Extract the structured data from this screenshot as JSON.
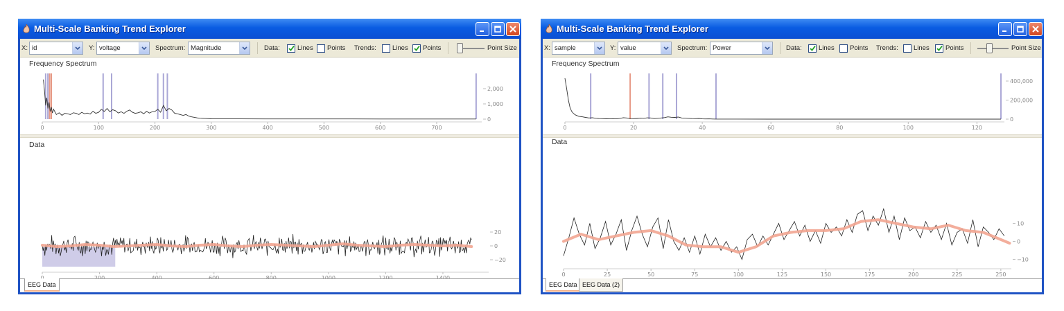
{
  "windows": [
    {
      "title": "Multi-Scale Banking Trend Explorer",
      "toolbar": {
        "x_label": "X:",
        "x_value": "id",
        "y_label": "Y:",
        "y_value": "voltage",
        "spectrum_label": "Spectrum:",
        "spectrum_value": "Magnitude",
        "data_label": "Data:",
        "data_lines": "Lines",
        "data_points": "Points",
        "data_lines_checked": true,
        "data_points_checked": false,
        "trends_label": "Trends:",
        "trends_lines": "Lines",
        "trends_points": "Points",
        "trends_lines_checked": false,
        "trends_points_checked": true,
        "point_size_label": "Point Size",
        "point_size_level": 0.0
      },
      "spectrum_panel": {
        "label": "Frequency Spectrum"
      },
      "data_panel": {
        "label": "Data"
      },
      "tabs": [
        "EEG Data"
      ],
      "active_tab": 0,
      "chart_data": [
        {
          "type": "line",
          "panel": "Frequency Spectrum",
          "x_ticks": [
            0,
            100,
            200,
            300,
            400,
            500,
            600,
            700
          ],
          "xlim": [
            0,
            780
          ],
          "y_ticks": [
            2000,
            1000,
            0
          ],
          "y_tick_labels": [
            "2,000",
            "1,000",
            "0"
          ],
          "ylim": [
            0,
            3000
          ],
          "x": [
            2,
            4,
            6,
            8,
            10,
            12,
            14,
            16,
            18,
            20,
            25,
            30,
            35,
            40,
            45,
            50,
            55,
            60,
            65,
            70,
            75,
            80,
            85,
            90,
            95,
            100,
            105,
            110,
            115,
            120,
            125,
            130,
            135,
            140,
            145,
            150,
            155,
            160,
            165,
            170,
            175,
            180,
            185,
            190,
            195,
            200,
            205,
            210,
            215,
            220,
            225,
            230,
            235,
            240,
            245,
            250,
            255,
            260,
            265,
            270,
            275,
            280,
            285,
            290,
            300,
            320,
            350,
            400,
            450,
            500,
            550,
            600,
            650,
            700,
            750,
            770
          ],
          "y": [
            2600,
            1800,
            900,
            1400,
            700,
            1100,
            500,
            800,
            400,
            650,
            300,
            420,
            250,
            380,
            350,
            300,
            420,
            380,
            300,
            450,
            350,
            400,
            330,
            520,
            380,
            450,
            650,
            500,
            700,
            480,
            620,
            550,
            400,
            480,
            380,
            520,
            600,
            450,
            380,
            420,
            480,
            350,
            520,
            400,
            480,
            500,
            650,
            450,
            900,
            550,
            700,
            600,
            380,
            350,
            300,
            250,
            300,
            200,
            150,
            120,
            80,
            60,
            50,
            40,
            25,
            20,
            18,
            15,
            15,
            12,
            12,
            10,
            10,
            10,
            10,
            10
          ],
          "bands": [
            {
              "x": 6,
              "color": "#aaa7d6"
            },
            {
              "x": 10,
              "color": "#aaa7d6"
            },
            {
              "x": 13,
              "color": "#e79a86"
            },
            {
              "x": 16,
              "color": "#e79a86"
            },
            {
              "x": 108,
              "color": "#aaa7d6"
            },
            {
              "x": 123,
              "color": "#aaa7d6"
            },
            {
              "x": 205,
              "color": "#aaa7d6"
            },
            {
              "x": 215,
              "color": "#aaa7d6"
            },
            {
              "x": 222,
              "color": "#aaa7d6"
            }
          ],
          "accent_bar": {
            "x": 770,
            "value": 3000,
            "color": "#aaa7d6"
          }
        },
        {
          "type": "line",
          "panel": "Data",
          "x_ticks": [
            0,
            200,
            400,
            600,
            800,
            1000,
            1200,
            1400
          ],
          "xlim": [
            0,
            1560
          ],
          "y_ticks": [
            20,
            0,
            -20
          ],
          "y_tick_labels": [
            "20",
            "0",
            "−20"
          ],
          "ylim": [
            -40,
            40
          ],
          "selection": {
            "x0": 0,
            "x1": 255,
            "color": "#cfcce8"
          },
          "noise_amplitude": 12,
          "trend_x": [
            0,
            50,
            100,
            150,
            200,
            250,
            300,
            350,
            400,
            450,
            500,
            550,
            600,
            650,
            700,
            750,
            800,
            850,
            900,
            950,
            1000,
            1050,
            1100,
            1150,
            1200,
            1250,
            1300,
            1350,
            1400,
            1450,
            1500
          ],
          "trend_y": [
            1,
            -1,
            0,
            2,
            1,
            -1,
            0,
            1,
            2,
            0,
            -1,
            1,
            2,
            0,
            -1,
            1,
            2,
            1,
            0,
            -1,
            1,
            3,
            1,
            0,
            -1,
            1,
            2,
            1,
            0,
            1,
            -1
          ]
        }
      ]
    },
    {
      "title": "Multi-Scale Banking Trend Explorer",
      "toolbar": {
        "x_label": "X:",
        "x_value": "sample",
        "y_label": "Y:",
        "y_value": "value",
        "spectrum_label": "Spectrum:",
        "spectrum_value": "Power",
        "data_label": "Data:",
        "data_lines": "Lines",
        "data_points": "Points",
        "data_lines_checked": true,
        "data_points_checked": false,
        "trends_label": "Trends:",
        "trends_lines": "Lines",
        "trends_points": "Points",
        "trends_lines_checked": false,
        "trends_points_checked": true,
        "point_size_label": "Point Size",
        "point_size_level": 0.35
      },
      "spectrum_panel": {
        "label": "Frequency Spectrum"
      },
      "data_panel": {
        "label": "Data"
      },
      "tabs": [
        "EEG Data",
        "EEG Data (2)"
      ],
      "active_tab": 0,
      "chart_data": [
        {
          "type": "line",
          "panel": "Frequency Spectrum",
          "x_ticks": [
            0,
            20,
            40,
            60,
            80,
            100,
            120
          ],
          "xlim": [
            0,
            128
          ],
          "y_ticks": [
            400000,
            200000,
            0
          ],
          "y_tick_labels": [
            "400,000",
            "200,000",
            "0"
          ],
          "ylim": [
            0,
            480000
          ],
          "x": [
            0,
            0.5,
            1,
            1.5,
            2,
            2.5,
            3,
            4,
            5,
            6,
            7,
            8,
            9,
            10,
            11,
            12,
            13,
            14,
            15,
            16,
            17,
            18,
            19,
            20,
            21,
            22,
            23,
            24,
            25,
            26,
            27,
            28,
            29,
            30,
            31,
            32,
            33,
            34,
            35,
            36,
            37,
            38,
            39,
            40,
            41,
            42,
            43,
            44,
            45,
            50,
            60,
            80,
            100,
            120,
            127
          ],
          "y": [
            430000,
            320000,
            200000,
            120000,
            80000,
            60000,
            45000,
            30000,
            25000,
            18000,
            12000,
            15000,
            9000,
            6000,
            5000,
            4000,
            3000,
            5000,
            3000,
            8000,
            15000,
            12000,
            6000,
            5000,
            7000,
            10000,
            9000,
            14000,
            12000,
            6000,
            9000,
            12000,
            16000,
            24000,
            20000,
            18000,
            22000,
            12000,
            10000,
            8000,
            6000,
            5000,
            7000,
            3000,
            2000,
            3000,
            1500,
            1000,
            800,
            500,
            300,
            200,
            150,
            120,
            100
          ],
          "bands": [
            {
              "x": 7.5,
              "color": "#aaa7d6"
            },
            {
              "x": 19,
              "color": "#e79a86"
            },
            {
              "x": 24.5,
              "color": "#aaa7d6"
            },
            {
              "x": 28.5,
              "color": "#aaa7d6"
            },
            {
              "x": 32.5,
              "color": "#aaa7d6"
            },
            {
              "x": 44,
              "color": "#aaa7d6"
            }
          ],
          "accent_bar": {
            "x": 127,
            "value": 480000,
            "color": "#aaa7d6"
          }
        },
        {
          "type": "line",
          "panel": "Data",
          "x_ticks": [
            0,
            25,
            50,
            75,
            100,
            125,
            150,
            175,
            200,
            225,
            250
          ],
          "xlim": [
            0,
            256
          ],
          "y_ticks": [
            10,
            0,
            -10
          ],
          "y_tick_labels": [
            "10",
            "0",
            "−10"
          ],
          "ylim": [
            -14,
            19
          ],
          "x": [
            0,
            3,
            6,
            9,
            12,
            15,
            18,
            21,
            24,
            27,
            30,
            33,
            36,
            39,
            42,
            45,
            48,
            51,
            54,
            57,
            60,
            63,
            66,
            69,
            72,
            75,
            78,
            81,
            84,
            87,
            90,
            93,
            96,
            99,
            102,
            105,
            108,
            111,
            114,
            117,
            120,
            123,
            126,
            129,
            132,
            135,
            138,
            141,
            144,
            147,
            150,
            153,
            156,
            159,
            162,
            165,
            168,
            171,
            174,
            177,
            180,
            183,
            186,
            189,
            192,
            195,
            198,
            201,
            204,
            207,
            210,
            213,
            216,
            219,
            222,
            225,
            228,
            231,
            234,
            237,
            240,
            243,
            246,
            249,
            252
          ],
          "y": [
            -8,
            2,
            13,
            4,
            -2,
            10,
            -4,
            2,
            11,
            -2,
            4,
            12,
            -5,
            6,
            14,
            4,
            -3,
            8,
            13,
            -4,
            12,
            0,
            -5,
            2,
            -6,
            3,
            -7,
            4,
            -3,
            2,
            -5,
            0,
            -6,
            -3,
            -10,
            1,
            4,
            -3,
            3,
            -2,
            4,
            10,
            1,
            6,
            11,
            3,
            9,
            0,
            6,
            -1,
            10,
            5,
            8,
            3,
            12,
            5,
            15,
            17,
            6,
            14,
            9,
            18,
            5,
            14,
            1,
            13,
            6,
            8,
            2,
            11,
            5,
            9,
            1,
            10,
            -2,
            5,
            7,
            -1,
            12,
            -3,
            8,
            5,
            1,
            7,
            3
          ],
          "trend_x": [
            0,
            10,
            20,
            30,
            40,
            50,
            60,
            70,
            80,
            90,
            100,
            110,
            120,
            130,
            140,
            150,
            160,
            170,
            180,
            190,
            200,
            210,
            220,
            230,
            240,
            250,
            255
          ],
          "trend_y": [
            0,
            4,
            1,
            3,
            5,
            6,
            3,
            -2,
            -3,
            -3,
            -6,
            -3,
            3,
            5,
            6,
            6,
            7,
            11,
            12,
            10,
            8,
            7,
            9,
            6,
            5,
            1,
            -1
          ]
        }
      ]
    }
  ]
}
